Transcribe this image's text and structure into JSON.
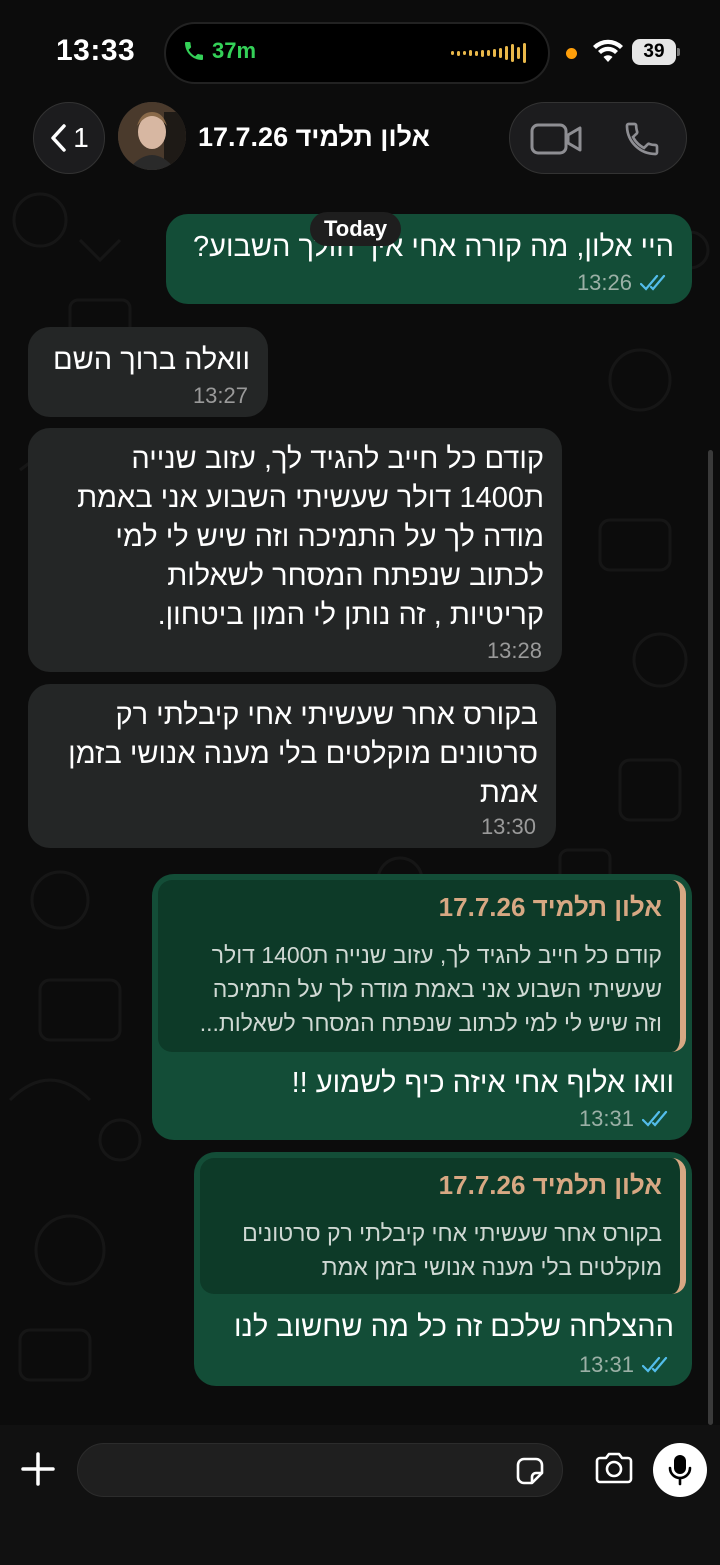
{
  "status_bar": {
    "time": "13:33",
    "call_duration": "37m",
    "battery": "39"
  },
  "header": {
    "back_count": "1",
    "contact_name": "אלון תלמיד 17.7.26"
  },
  "chat": {
    "date_label": "Today",
    "messages": [
      {
        "direction": "out",
        "text": "היי אלון, מה קורה אחי איך הולך השבוע?",
        "time": "13:26",
        "read": true
      },
      {
        "direction": "in",
        "text": "וואלה ברוך השם",
        "time": "13:27"
      },
      {
        "direction": "in",
        "lines": [
          "קודם כל חייב להגיד לך, עזוב שנייה",
          "ת1400 דולר שעשיתי השבוע אני באמת",
          "מודה לך על התמיכה וזה שיש לי למי",
          "לכתוב שנפתח המסחר לשאלות",
          "קריטיות , זה נותן לי המון ביטחון."
        ],
        "time": "13:28"
      },
      {
        "direction": "in",
        "lines": [
          "בקורס אחר שעשיתי אחי קיבלתי רק",
          "סרטונים מוקלטים בלי מענה אנושי בזמן",
          "אמת"
        ],
        "time": "13:30"
      },
      {
        "direction": "out",
        "quote_name": "אלון תלמיד 17.7.26",
        "quote_lines": [
          "קודם כל חייב להגיד לך, עזוב שנייה ת1400 דולר",
          "שעשיתי השבוע אני באמת מודה לך על התמיכה",
          "וזה שיש לי למי לכתוב שנפתח המסחר לשאלות..."
        ],
        "text": "וואו אלוף אחי איזה כיף לשמוע !!",
        "time": "13:31",
        "read": true
      },
      {
        "direction": "out",
        "quote_name": "אלון תלמיד 17.7.26",
        "quote_lines": [
          "בקורס אחר שעשיתי אחי קיבלתי רק סרטונים",
          "מוקלטים בלי מענה אנושי בזמן אמת"
        ],
        "text": "ההצלחה שלכם זה כל מה שחשוב לנו",
        "time": "13:31",
        "read": true
      }
    ]
  },
  "input": {
    "placeholder": ""
  },
  "colors": {
    "outgoing_bubble": "#134d37",
    "incoming_bubble": "#242626",
    "read_ticks": "#53bdeb",
    "quote_accent": "#d7a883",
    "call_green": "#34d158"
  },
  "icons": [
    "phone-icon",
    "wifi-icon",
    "chevron-left-icon",
    "video-icon",
    "plus-icon",
    "sticker-icon",
    "camera-icon",
    "mic-icon",
    "double-check-icon"
  ]
}
